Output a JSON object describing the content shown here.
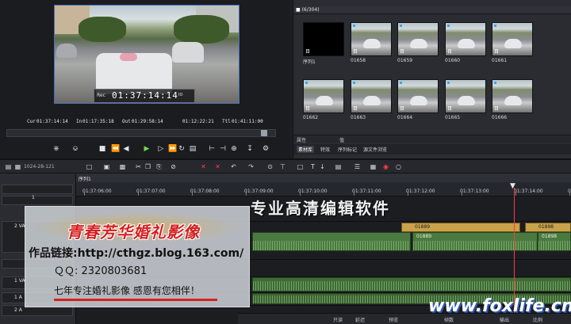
{
  "player": {
    "preview": {
      "rec_label": "Rec",
      "timecode": "01:37:14:14",
      "io_label": "IO"
    },
    "timecodes": {
      "cur_label": "Cur",
      "cur": "01:37:14:14",
      "in_label": "In",
      "in": "01:17:35:18",
      "out_label": "Out",
      "out": "01:29:58:14",
      "dur_label": "",
      "dur": "01:12:22:21",
      "ttl_label": "Ttl",
      "ttl": "01:41:11:00"
    }
  },
  "bin": {
    "header": "(6/304)",
    "clips": [
      {
        "label": "序列1",
        "type": "目"
      },
      {
        "label": "01658",
        "type": "目"
      },
      {
        "label": "01659",
        "type": "目"
      },
      {
        "label": "01660",
        "type": "目"
      },
      {
        "label": "01661",
        "type": "目"
      },
      {
        "label": "01662",
        "type": "目"
      },
      {
        "label": "01663",
        "type": "目"
      },
      {
        "label": "01664",
        "type": "目"
      },
      {
        "label": "01665",
        "type": "目"
      },
      {
        "label": "01666",
        "type": "目"
      }
    ],
    "props_col1": "属性",
    "props_col2": "值",
    "tabs": [
      "素材库",
      "特效",
      "序列标记",
      "源文件浏览"
    ]
  },
  "toolbar": {
    "sequence_label": "1024-28-121"
  },
  "timeline": {
    "seq_tab": "序列1",
    "ruler": [
      "01:37:06:00",
      "01:37:07:00",
      "01:37:08:00",
      "01:37:09:00",
      "01:37:10:00",
      "01:37:11:00",
      "01:37:12:00",
      "01:37:13:00",
      "01:37:14:00",
      "01:37:15:00"
    ],
    "tracks": {
      "t1": "1",
      "t2": "2 VA",
      "t3": "1 VA",
      "t5": "1 A",
      "t6": "2 A"
    },
    "clips": {
      "v1": "01889",
      "v2": "01889",
      "a1": "01889",
      "a2": "01898",
      "v3": "01898"
    }
  },
  "overlay": {
    "brand": "青春芳华婚礼影像",
    "link": "作品链接:http://cthgz.blog.163.com/",
    "qq_label": "ＱＱ:",
    "qq": "2320803681",
    "slogan": "七年专注婚礼影像  感恩有您相伴！"
  },
  "caption": "专业高清编辑软件",
  "watermark": "www.foxlife.cn",
  "bottombar": [
    "只读",
    "延迟",
    "预览",
    "帧数",
    "输出",
    "比例"
  ]
}
